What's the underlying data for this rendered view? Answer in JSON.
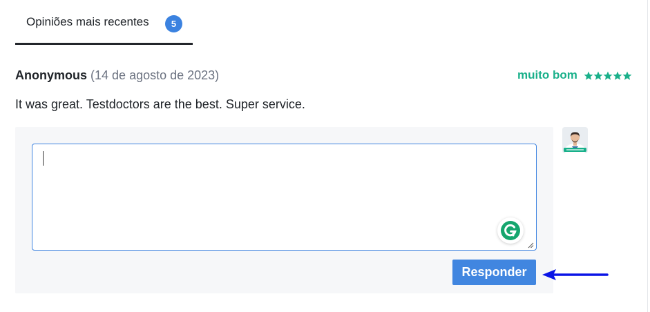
{
  "tabs": {
    "active_label": "Opiniões mais recentes",
    "count_badge": "5"
  },
  "review": {
    "author": "Anonymous",
    "date": "(14 de agosto de 2023)",
    "rating_label": "muito bom",
    "rating_stars": 5,
    "text": "It was great. Testdoctors are the best. Super service."
  },
  "reply": {
    "textarea_value": "",
    "submit_label": "Responder",
    "avatar_icon": "doctor-avatar-icon",
    "grammarly_icon": "grammarly-icon"
  },
  "colors": {
    "accent_blue": "#4186e0",
    "rating_green": "#19b08a",
    "annotation_arrow": "#0a14e6"
  }
}
